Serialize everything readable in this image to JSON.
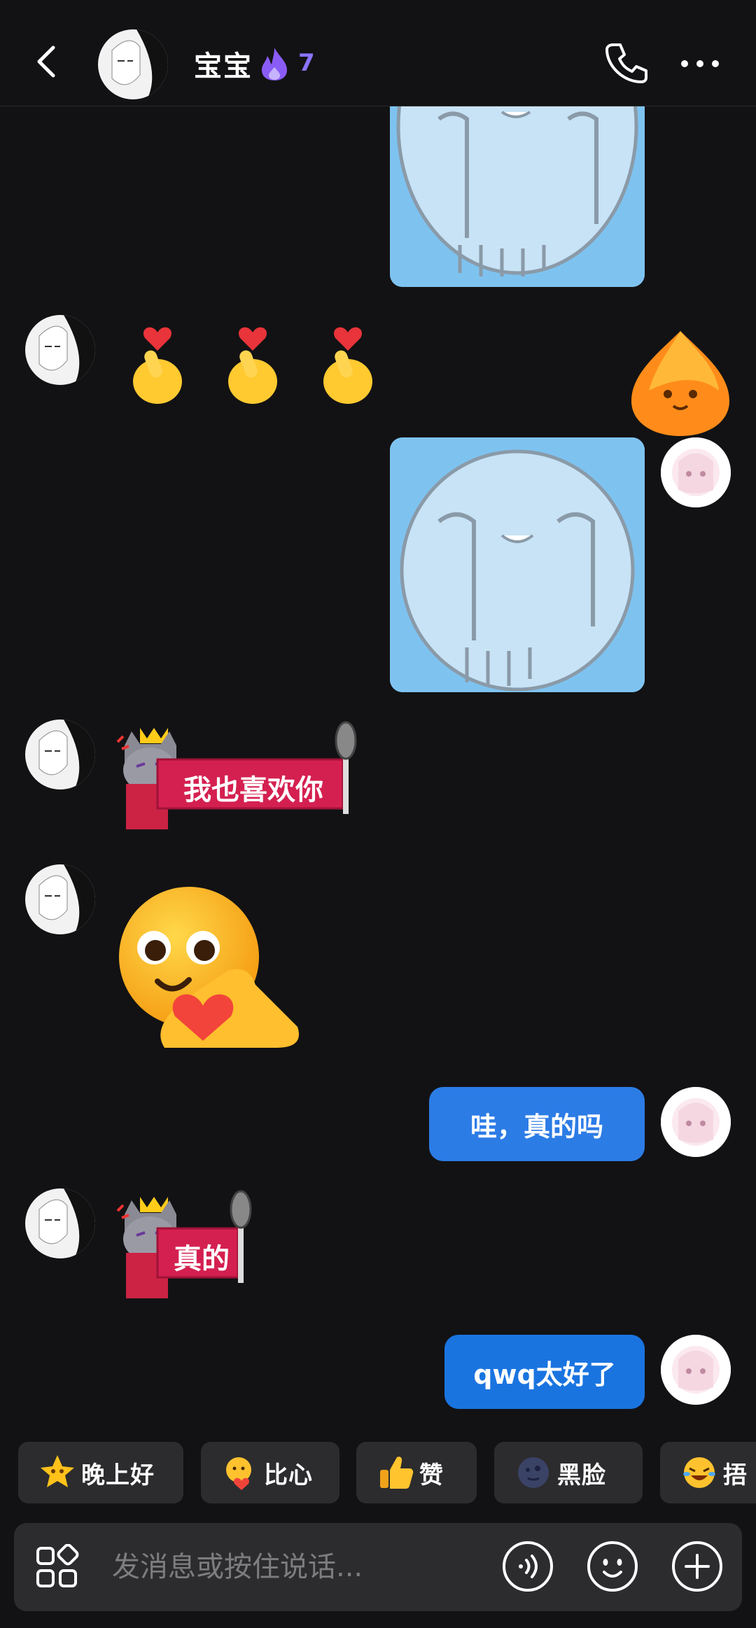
{
  "header": {
    "back_icon": "chevron-left-icon",
    "contact_name": "宝宝",
    "streak_icon": "flame-icon",
    "streak_count": "7",
    "phone_icon": "phone-icon",
    "more_icon": "more-dots-icon"
  },
  "messages": {
    "cat_sticker_1_text": "我也喜欢你",
    "bubble_1": "哇，真的吗",
    "cat_sticker_2_text": "真的",
    "bubble_2": "qwq太好了"
  },
  "quick_replies": [
    {
      "label": "晚上好",
      "icon": "star-face-icon"
    },
    {
      "label": "比心",
      "icon": "heart-hands-icon"
    },
    {
      "label": "赞",
      "icon": "thumbs-up-icon"
    },
    {
      "label": "黑脸",
      "icon": "dark-moon-face-icon"
    },
    {
      "label": "捂",
      "icon": "laughing-face-icon"
    }
  ],
  "input": {
    "placeholder": "发消息或按住说话..."
  },
  "colors": {
    "background": "#121214",
    "bubble_blue": "#2c7ce6",
    "streak_purple": "#8a73ff",
    "chip_bg": "#2c2c2e"
  }
}
